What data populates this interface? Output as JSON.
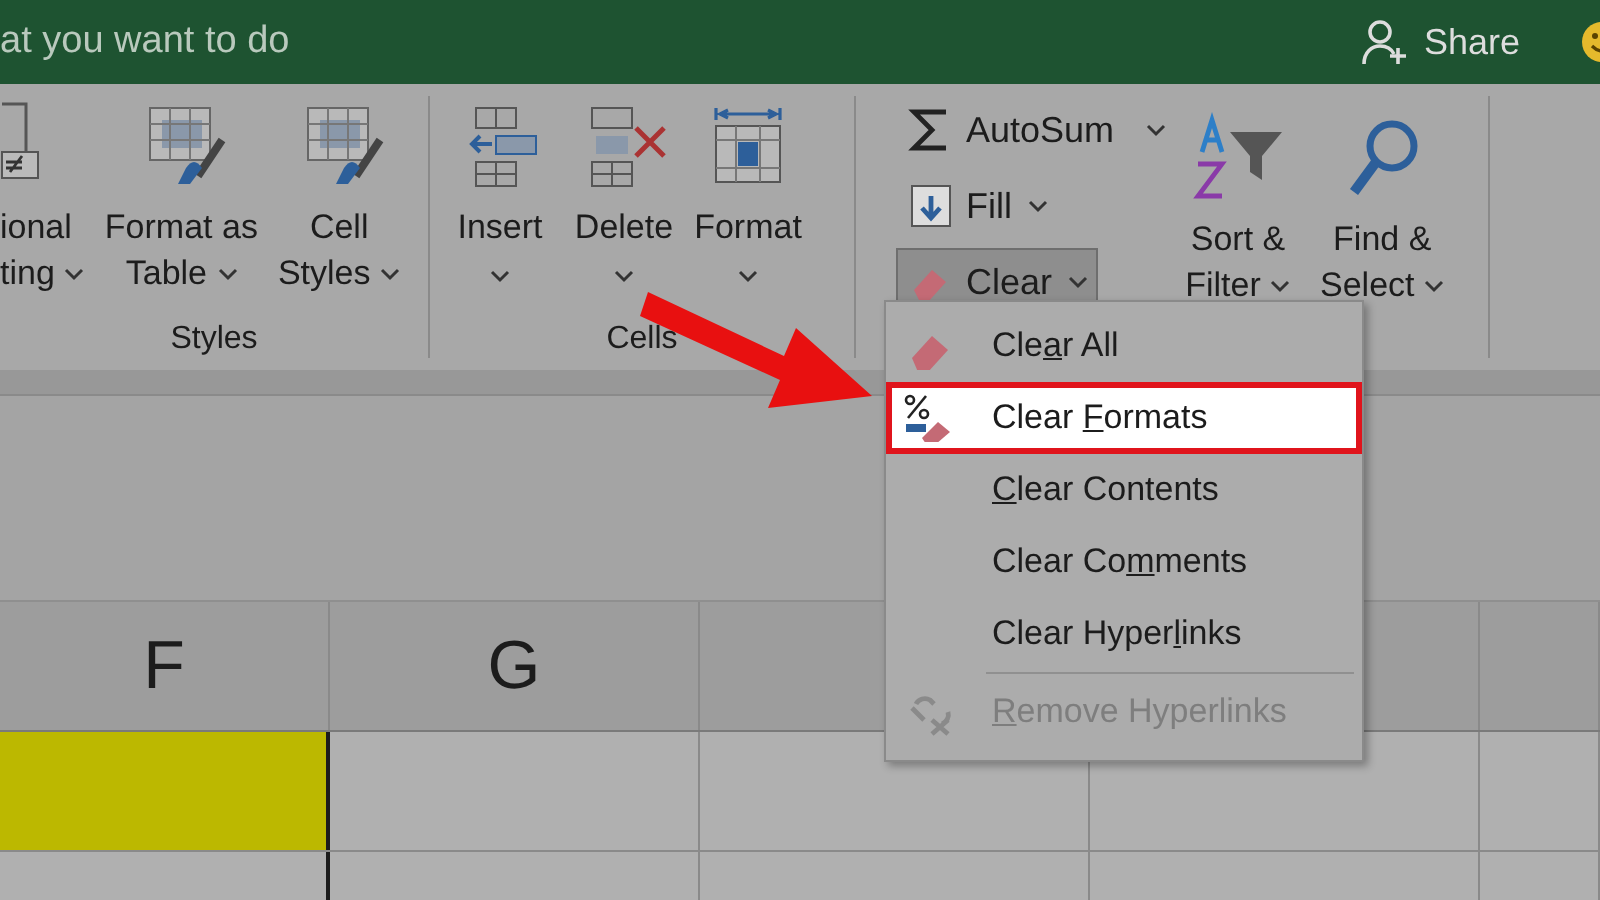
{
  "title_bar": {
    "search_hint": "at you want to do",
    "share": "Share"
  },
  "ribbon": {
    "groups": [
      {
        "label": "Styles",
        "buttons": [
          {
            "kind": "conditional",
            "lines": [
              "ional",
              "ting"
            ],
            "dropdown": true
          },
          {
            "kind": "table",
            "lines": [
              "Format as",
              "Table"
            ],
            "dropdown": true
          },
          {
            "kind": "cellstyles",
            "lines": [
              "Cell",
              "Styles"
            ],
            "dropdown": true
          }
        ]
      },
      {
        "label": "Cells",
        "buttons": [
          {
            "kind": "insert",
            "lines": [
              "Insert"
            ],
            "dropdown": true
          },
          {
            "kind": "delete",
            "lines": [
              "Delete"
            ],
            "dropdown": true
          },
          {
            "kind": "format",
            "lines": [
              "Format"
            ],
            "dropdown": true
          }
        ]
      }
    ],
    "editing": {
      "small": [
        {
          "kind": "autosum",
          "label": "AutoSum",
          "dropdown": true,
          "pressed": false
        },
        {
          "kind": "fill",
          "label": "Fill",
          "dropdown": true,
          "pressed": false
        },
        {
          "kind": "clear",
          "label": "Clear",
          "dropdown": true,
          "pressed": true
        }
      ],
      "large": [
        {
          "kind": "sort",
          "lines": [
            "Sort &",
            "Filter"
          ],
          "dropdown": true
        },
        {
          "kind": "find",
          "lines": [
            "Find &",
            "Select"
          ],
          "dropdown": true
        }
      ]
    }
  },
  "clear_menu": {
    "items": [
      {
        "kind": "eraser",
        "before": "Cle",
        "key": "a",
        "after": "r All",
        "selected": false,
        "disabled": false
      },
      {
        "kind": "formats",
        "before": "Clear ",
        "key": "F",
        "after": "ormats",
        "selected": true,
        "disabled": false
      },
      {
        "kind": "plain",
        "key": "C",
        "after": "lear Contents",
        "selected": false,
        "disabled": false
      },
      {
        "kind": "plain",
        "before": "Clear Co",
        "key": "m",
        "after": "ments",
        "selected": false,
        "disabled": false
      },
      {
        "kind": "plain",
        "before": "Clear Hyper",
        "key": "l",
        "after": "inks",
        "selected": false,
        "disabled": false
      },
      {
        "kind": "unlink",
        "key": "R",
        "after": "emove Hyperlinks",
        "selected": false,
        "disabled": true
      }
    ]
  },
  "sheet": {
    "columns": [
      {
        "label": "F"
      },
      {
        "label": "G"
      }
    ],
    "filled_cell": {
      "color": "#bcb800"
    }
  }
}
